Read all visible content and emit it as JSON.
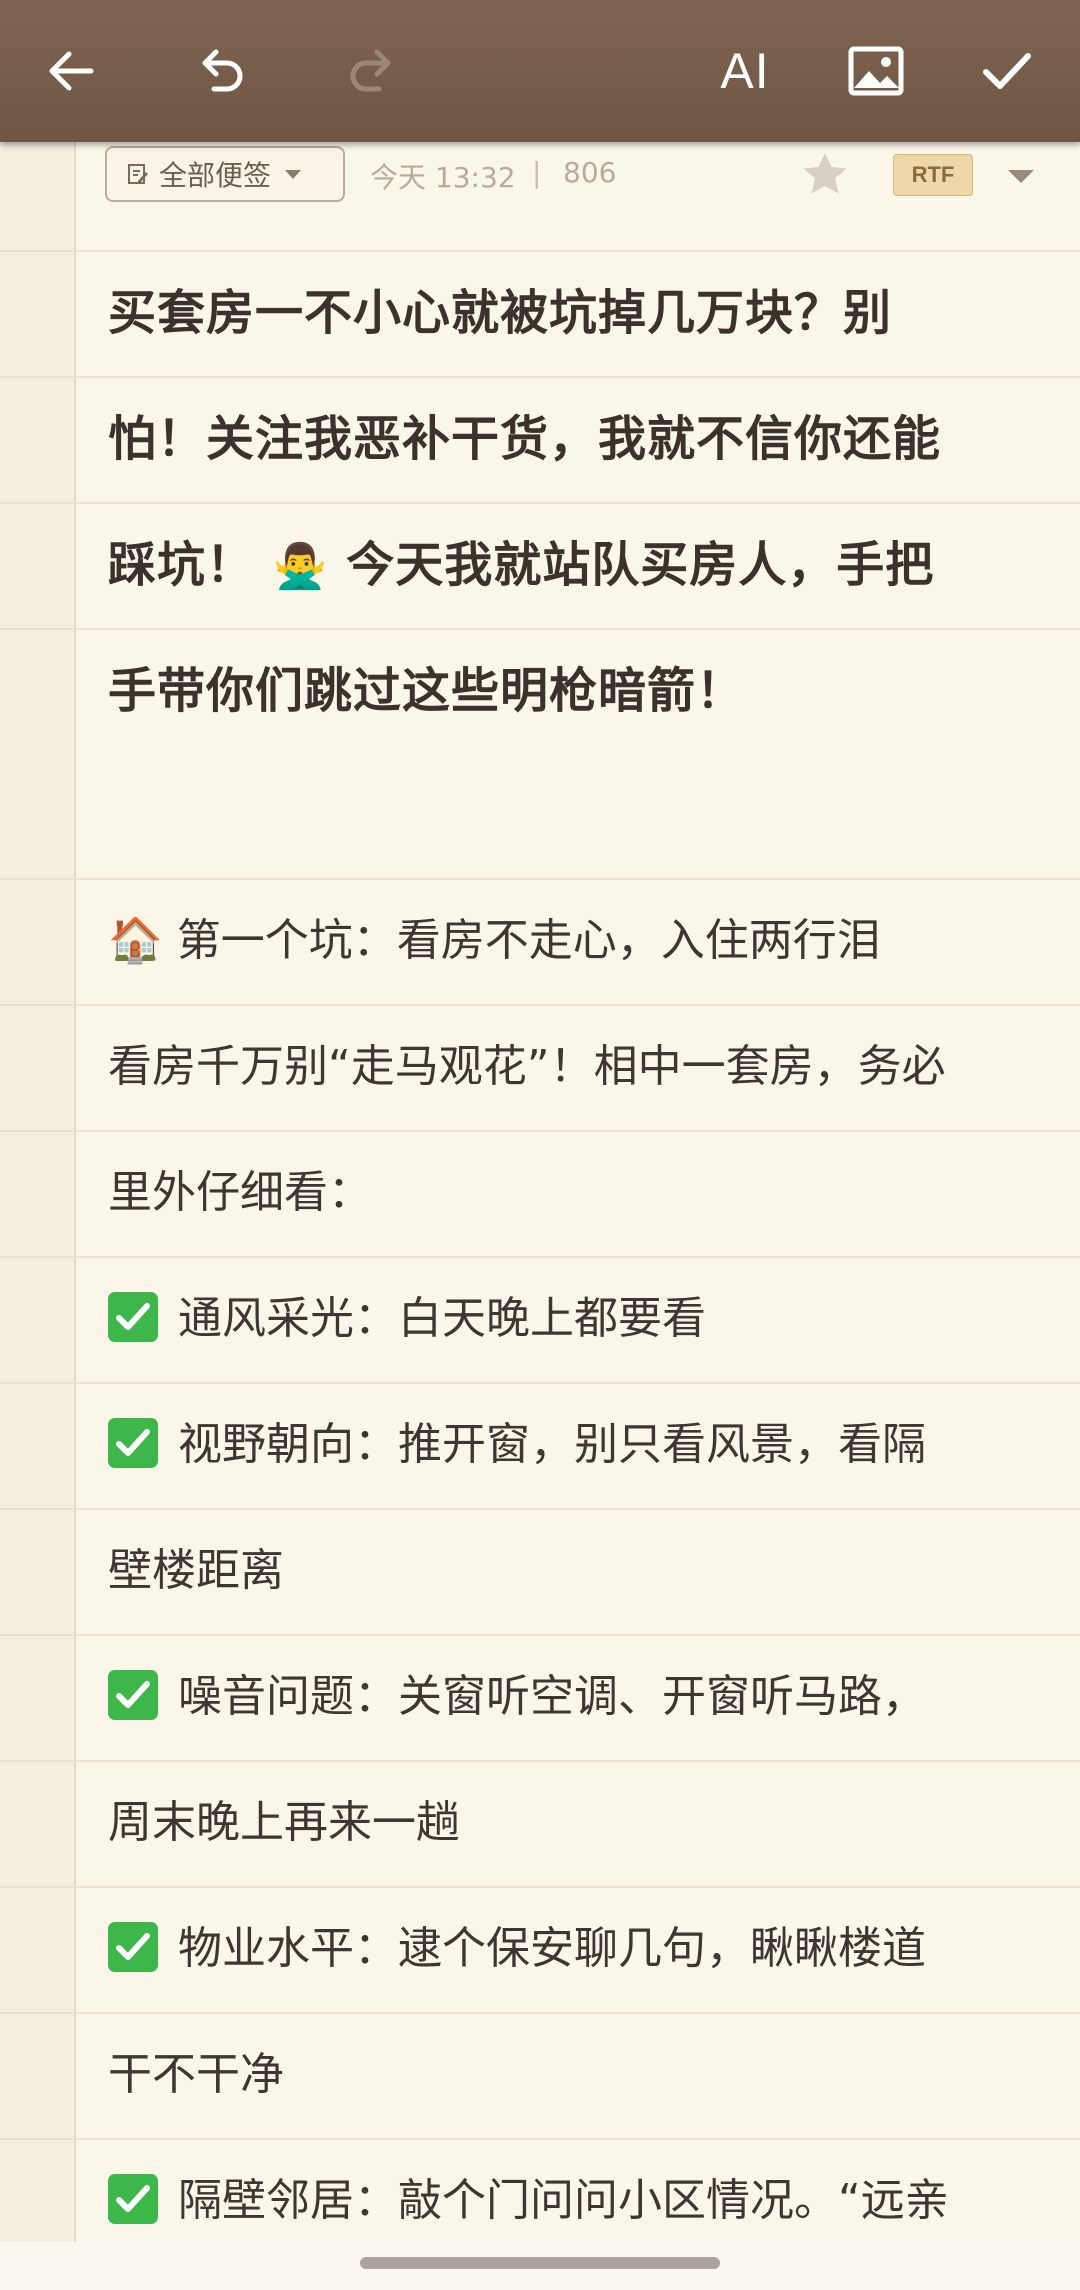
{
  "toolbar": {
    "back_icon": "arrow-left-icon",
    "undo_icon": "undo-icon",
    "redo_icon": "redo-icon",
    "ai_label": "AI",
    "image_icon": "image-icon",
    "check_icon": "check-icon",
    "color": "#7a604d"
  },
  "meta": {
    "folder_label": "全部便签",
    "time": "今天 13:32",
    "separator": "|",
    "char_count": "806",
    "format_badge": "RTF"
  },
  "note": {
    "title_lines": [
      "买套房一不小心就被坑掉几万块？别",
      "怕！关注我恶补干货，我就不信你还能",
      "踩坑！",
      "今天我就站队买房人，手把",
      "手带你们跳过这些明枪暗箭！"
    ],
    "title_emoji": "🙅‍♂️",
    "body_lines": [
      {
        "emoji": "🏠",
        "text": "第一个坑：看房不走心，入住两行泪"
      },
      {
        "text": "看房千万别“走马观花”！相中一套房，务必"
      },
      {
        "text": "里外仔细看："
      },
      {
        "check": true,
        "text": "通风采光：白天晚上都要看"
      },
      {
        "check": true,
        "text": "视野朝向：推开窗，别只看风景，看隔"
      },
      {
        "text": "壁楼距离"
      },
      {
        "check": true,
        "text": "噪音问题：关窗听空调、开窗听马路，"
      },
      {
        "text": "周末晚上再来一趟"
      },
      {
        "check": true,
        "text": "物业水平：逮个保安聊几句，瞅瞅楼道"
      },
      {
        "text": "干不干净"
      },
      {
        "check": true,
        "text": "隔壁邻居：敲个门问问小区情况。“远亲"
      }
    ]
  }
}
